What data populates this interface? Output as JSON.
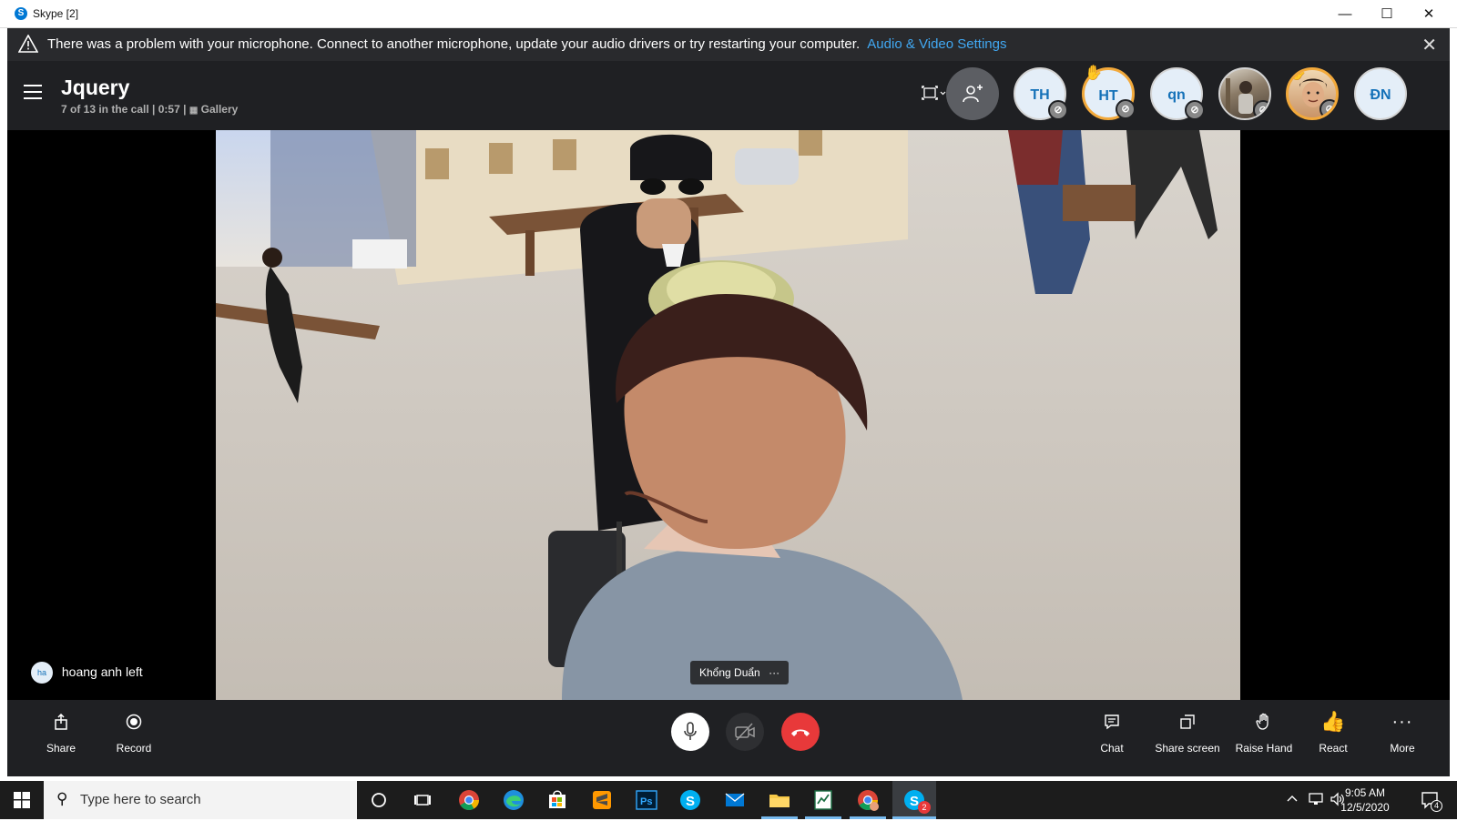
{
  "window": {
    "title": "Skype [2]",
    "app_icon_letter": "S"
  },
  "warning": {
    "message": "There was a problem with your microphone. Connect to another microphone, update your audio drivers or try restarting your computer.",
    "link": "Audio & Video Settings"
  },
  "call": {
    "title": "Jquery",
    "participants_text": "7 of 13 in the call",
    "separator": "|",
    "duration": "0:57",
    "view_mode": "Gallery"
  },
  "participants": [
    {
      "initials": "TH",
      "muted": true,
      "hand_raised": false
    },
    {
      "initials": "HT",
      "muted": true,
      "hand_raised": true
    },
    {
      "initials": "qn",
      "muted": true,
      "hand_raised": false
    },
    {
      "initials": "",
      "photo": true,
      "muted": true,
      "hand_raised": false
    },
    {
      "initials": "",
      "photo": true,
      "muted": true,
      "hand_raised": true
    },
    {
      "initials": "ĐN",
      "muted": false,
      "hand_raised": false
    }
  ],
  "stage": {
    "speaker_name": "Khổng Duẩn",
    "speaker_more": "···",
    "left_notice_initials": "ha",
    "left_notice": "hoang anh left"
  },
  "controls": {
    "share": "Share",
    "record": "Record",
    "chat": "Chat",
    "share_screen": "Share screen",
    "raise_hand": "Raise Hand",
    "react": "React",
    "more": "More"
  },
  "taskbar": {
    "search_placeholder": "Type here to search",
    "time": "9:05 AM",
    "date": "12/5/2020",
    "notification_count": "4",
    "skype_badge": "2"
  },
  "colors": {
    "accent_link": "#41a8f2",
    "hangup": "#e8393a",
    "hand_raise": "#f2a93b",
    "bar_background": "#1f2023"
  }
}
